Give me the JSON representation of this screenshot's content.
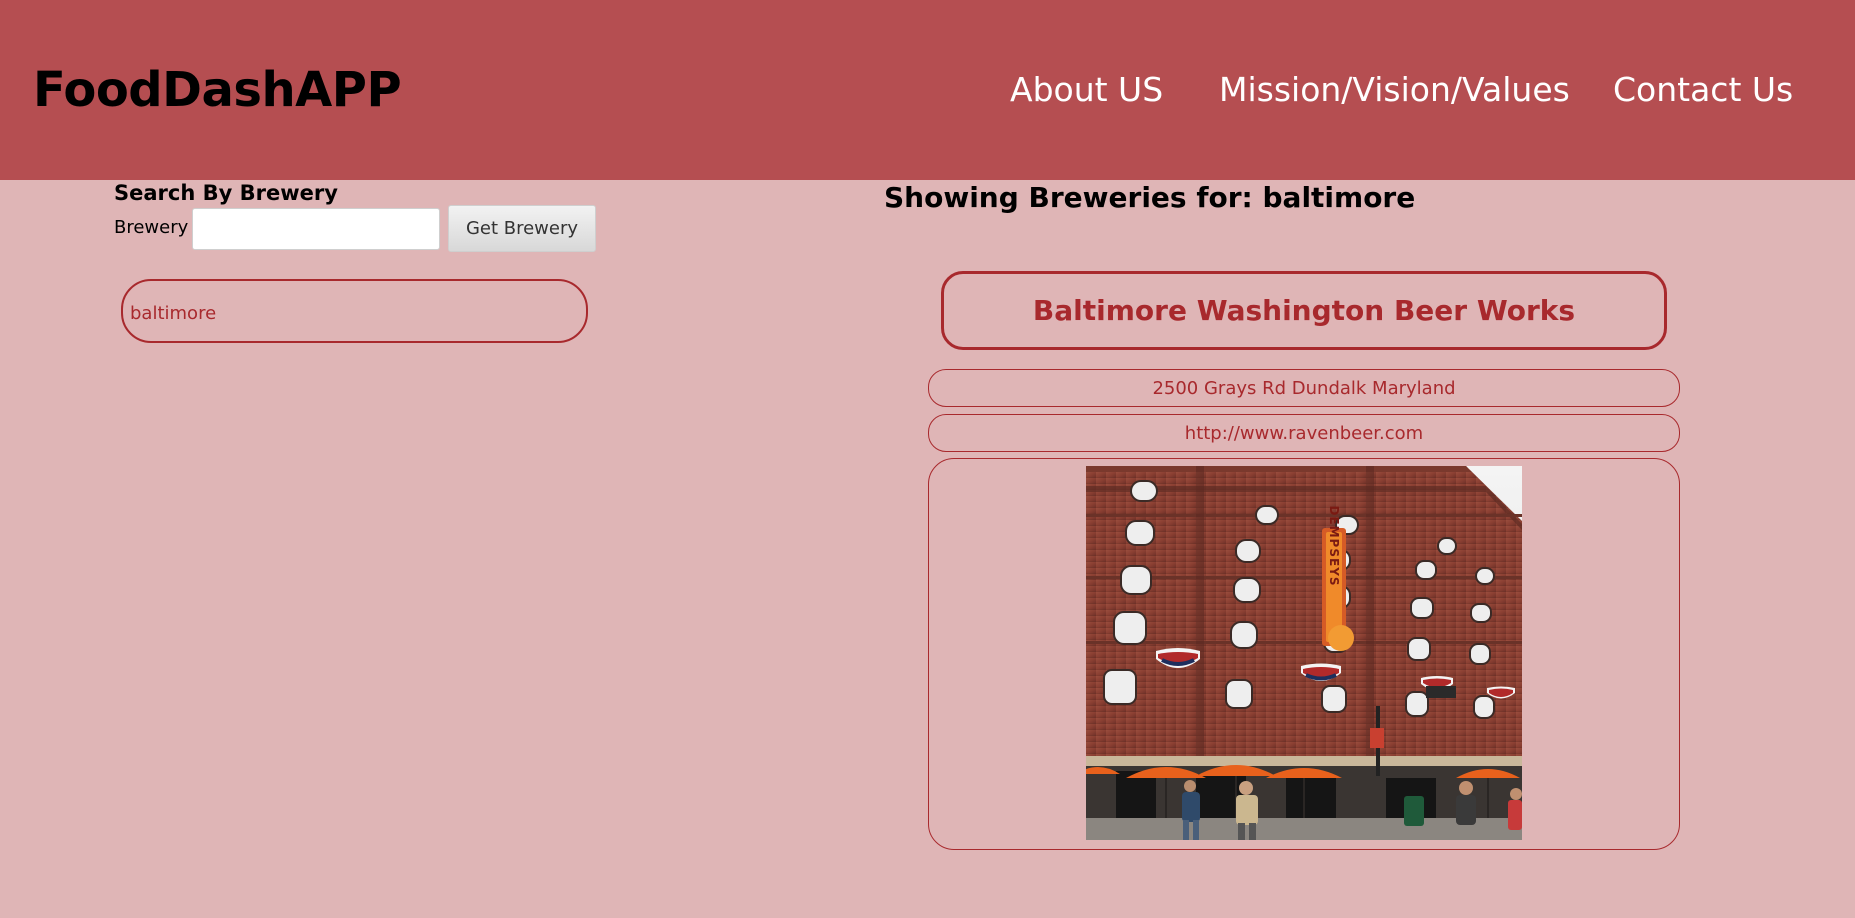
{
  "header": {
    "app_name": "FoodDashAPP",
    "nav": [
      "About US",
      "Mission/Vision/Values",
      "Contact Us"
    ]
  },
  "search": {
    "title": "Search By Brewery",
    "field_label": "Brewery",
    "input_value": "",
    "button_label": "Get Brewery"
  },
  "history": [
    "baltimore"
  ],
  "results": {
    "heading": "Showing Breweries for: baltimore",
    "brewery": {
      "name": "Baltimore Washington Beer Works",
      "address": "2500 Grays Rd Dundalk Maryland",
      "website": "http://www.ravenbeer.com",
      "photo_sign_text": "DEMPSEYS"
    }
  },
  "colors": {
    "header_bg": "#b54e51",
    "page_bg": "#dfb5b6",
    "accent": "#a8292d",
    "nav_text": "#ffffff"
  }
}
